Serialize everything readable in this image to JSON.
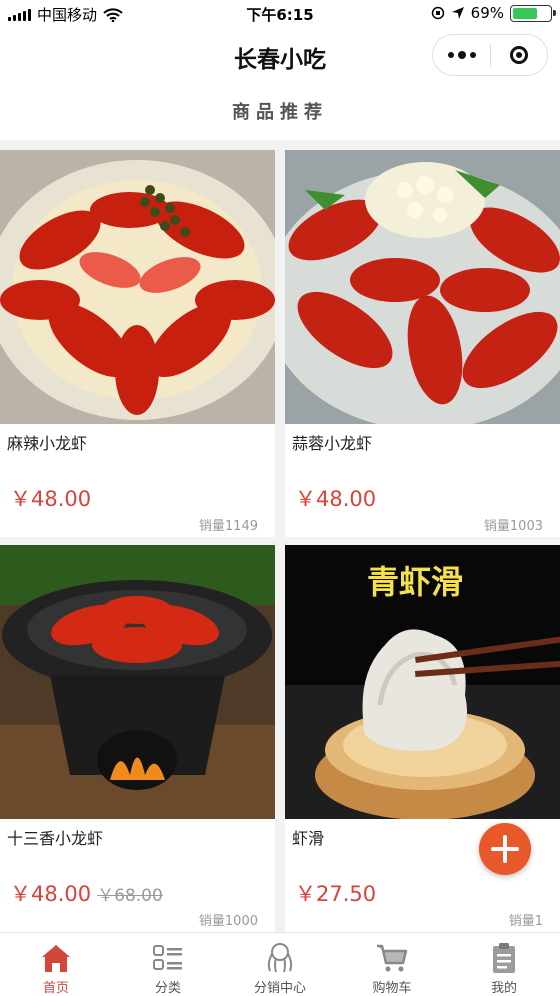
{
  "status_bar": {
    "carrier": "中国移动",
    "time": "下午6:15",
    "battery_percent": "69%",
    "battery_level": 0.69,
    "icons": [
      "signal-icon",
      "wifi-icon",
      "orientation-lock-icon",
      "location-icon",
      "battery-icon"
    ]
  },
  "nav": {
    "title": "长春小吃",
    "capsule_icons": [
      "more-dots-icon",
      "close-target-icon"
    ]
  },
  "section": {
    "title": "商品推荐"
  },
  "products": [
    {
      "name": "麻辣小龙虾",
      "price": "￥48.00",
      "original_price": "",
      "sales": "销量1149",
      "image": "spicy-crayfish-photo"
    },
    {
      "name": "蒜蓉小龙虾",
      "price": "￥48.00",
      "original_price": "",
      "sales": "销量1003",
      "image": "garlic-crayfish-photo"
    },
    {
      "name": "十三香小龙虾",
      "price": "￥48.00",
      "original_price": "￥68.00",
      "sales": "销量1000",
      "image": "thirteen-spice-crayfish-photo"
    },
    {
      "name": "虾滑",
      "price": "￥27.50",
      "original_price": "",
      "sales": "销量1",
      "image": "shrimp-paste-photo",
      "image_caption": "青虾滑"
    }
  ],
  "tabbar": {
    "items": [
      {
        "label": "首页",
        "icon": "home-icon",
        "active": true
      },
      {
        "label": "分类",
        "icon": "category-list-icon",
        "active": false
      },
      {
        "label": "分销中心",
        "icon": "distribution-icon",
        "active": false
      },
      {
        "label": "购物车",
        "icon": "cart-icon",
        "active": false
      },
      {
        "label": "我的",
        "icon": "clipboard-icon",
        "active": false
      }
    ]
  },
  "colors": {
    "accent": "#c94a3f",
    "price": "#d9433a",
    "fab": "#e9582a"
  }
}
